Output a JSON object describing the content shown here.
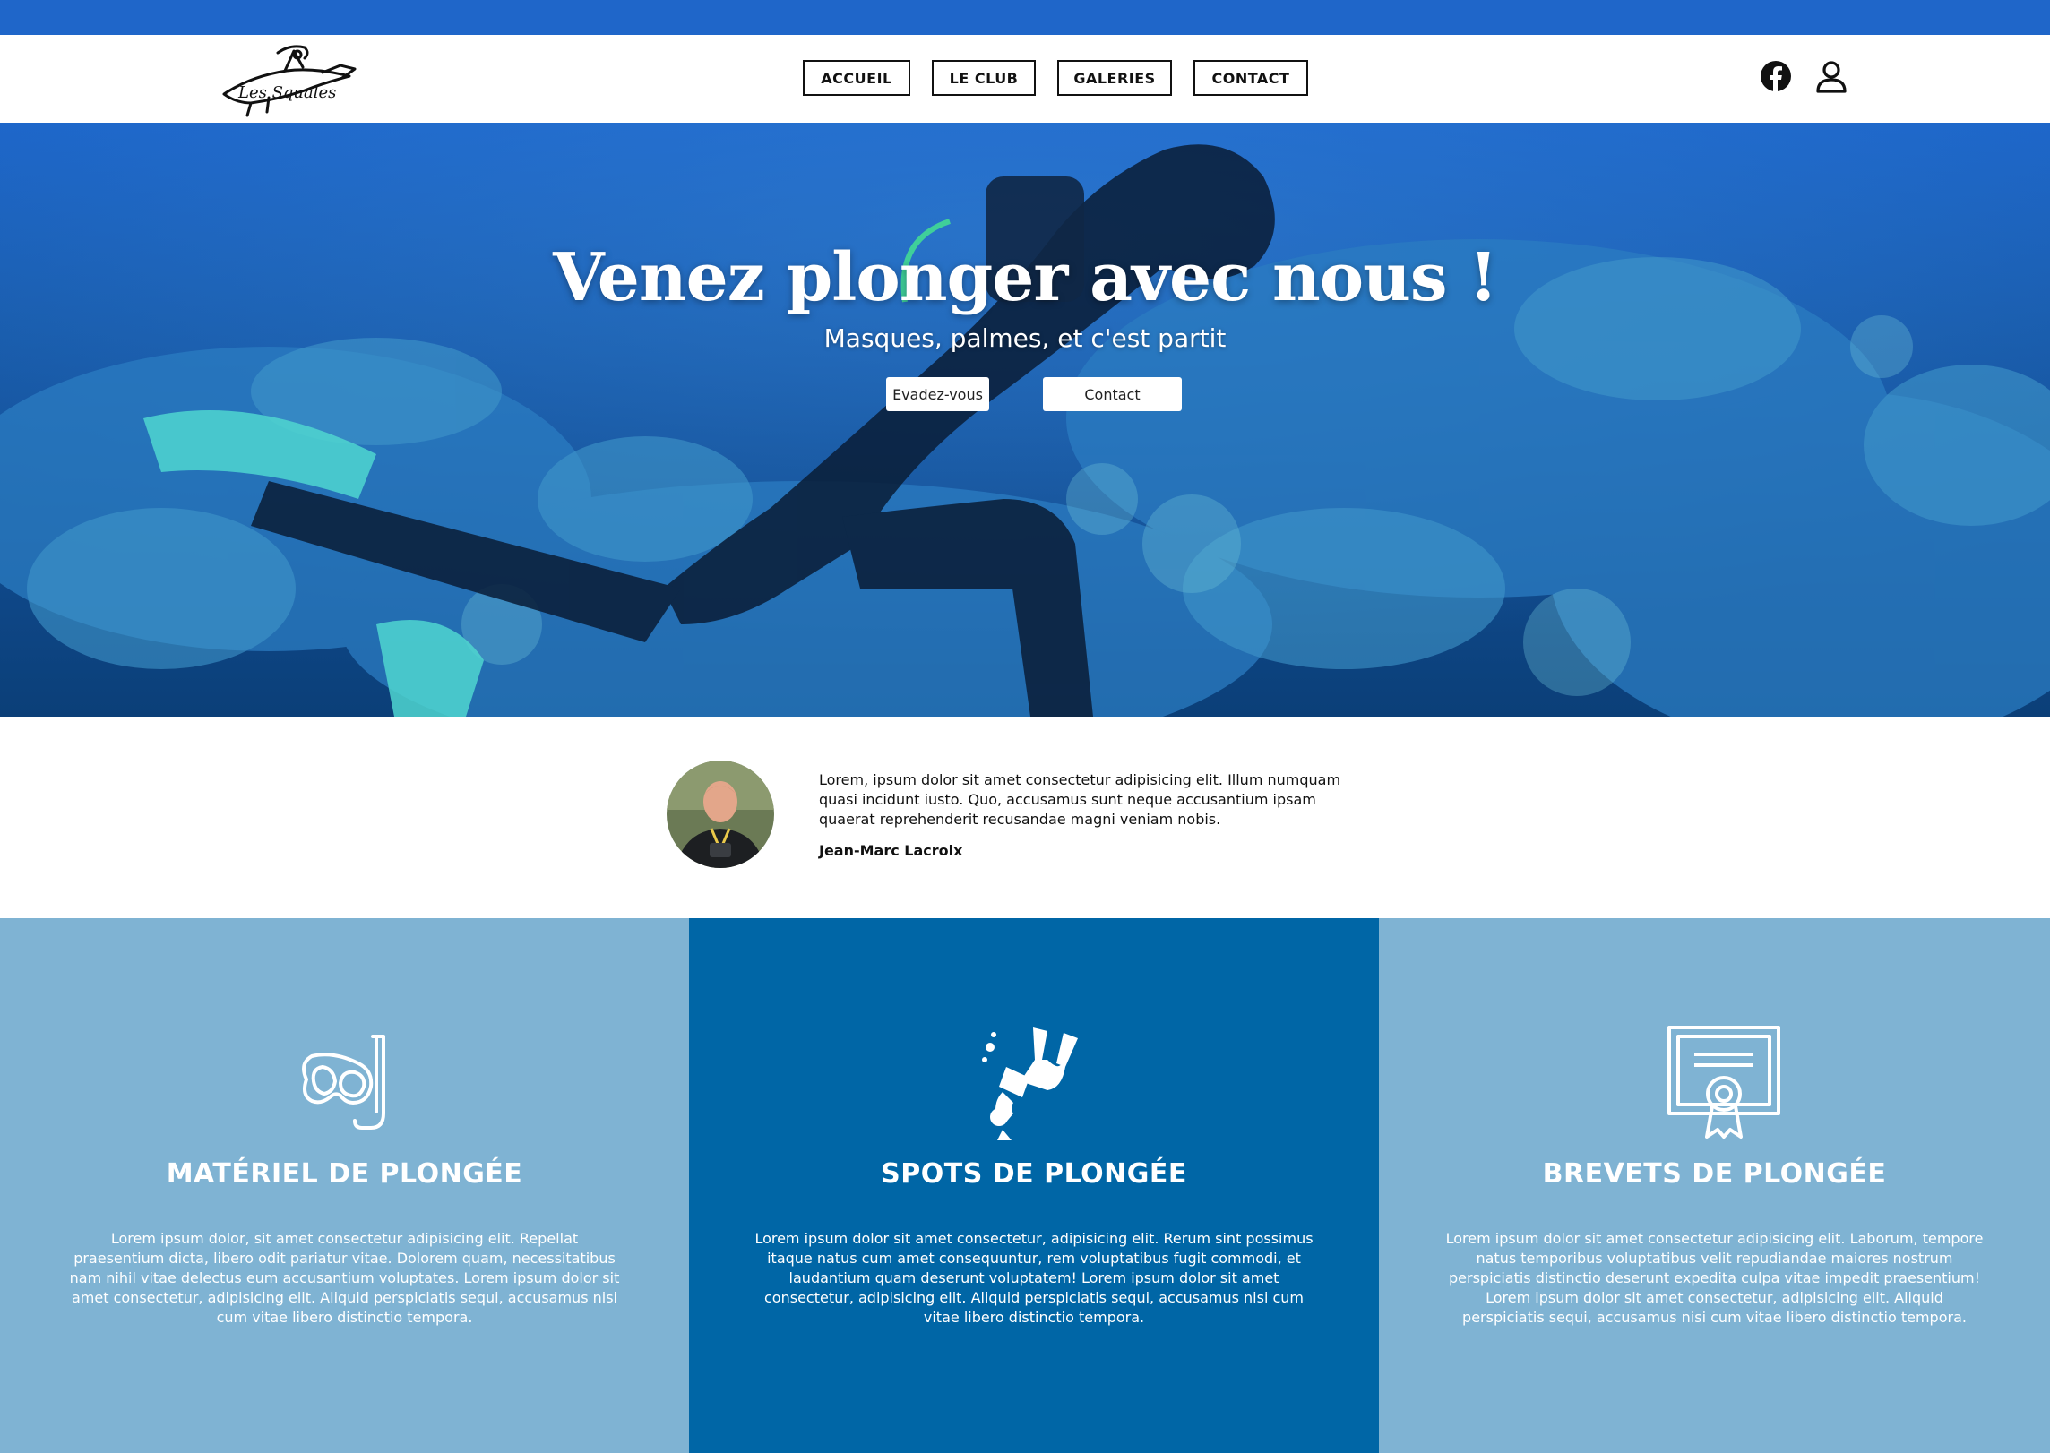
{
  "nav": {
    "logo_text": "Les Squales",
    "links": [
      "ACCUEIL",
      "LE CLUB",
      "GALERIES",
      "CONTACT"
    ],
    "icons": [
      "facebook-icon",
      "user-icon"
    ]
  },
  "hero": {
    "title": "Venez plonger avec nous !",
    "subtitle": "Masques, palmes, et c'est partit",
    "buttons": [
      "Evadez-vous",
      "Contact"
    ]
  },
  "testimonial": {
    "quote": "Lorem, ipsum dolor sit amet consectetur adipisicing elit. Illum numquam quasi incidunt iusto. Quo, accusamus sunt neque accusantium ipsam quaerat reprehenderit recusandae magni veniam nobis.",
    "author": "Jean-Marc Lacroix"
  },
  "features": [
    {
      "icon": "diving-mask-icon",
      "title": "MATÉRIEL DE PLONGÉE",
      "text": "Lorem ipsum dolor, sit amet consectetur adipisicing elit. Repellat praesentium dicta, libero odit pariatur vitae. Dolorem quam, necessitatibus nam nihil vitae delectus eum accusantium voluptates. Lorem ipsum dolor sit amet consectetur, adipisicing elit. Aliquid perspiciatis sequi, accusamus nisi cum vitae libero distinctio tempora."
    },
    {
      "icon": "scuba-diver-icon",
      "title": "SPOTS DE PLONGÉE",
      "text": "Lorem ipsum dolor sit amet consectetur, adipisicing elit. Rerum sint possimus itaque natus cum amet consequuntur, rem voluptatibus fugit commodi, et laudantium quam deserunt voluptatem! Lorem ipsum dolor sit amet consectetur, adipisicing elit. Aliquid perspiciatis sequi, accusamus nisi cum vitae libero distinctio tempora."
    },
    {
      "icon": "certificate-icon",
      "title": "BREVETS DE PLONGÉE",
      "text": "Lorem ipsum dolor sit amet consectetur adipisicing elit. Laborum, tempore natus temporibus voluptatibus velit repudiandae maiores nostrum perspiciatis distinctio deserunt expedita culpa vitae impedit praesentium! Lorem ipsum dolor sit amet consectetur, adipisicing elit. Aliquid perspiciatis sequi, accusamus nisi cum vitae libero distinctio tempora."
    }
  ],
  "colors": {
    "top_strip": "#1f66c9",
    "feature_light": "#7fb3d3",
    "feature_dark": "#0066a6"
  }
}
